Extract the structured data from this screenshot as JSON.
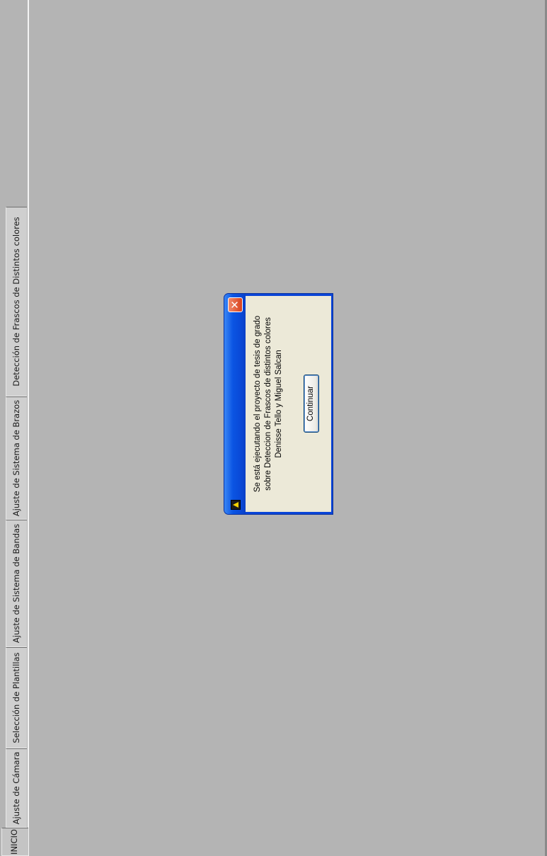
{
  "tabs": [
    {
      "label": "INICIO",
      "active": true
    },
    {
      "label": "Ajuste de Cámara",
      "active": false
    },
    {
      "label": "Selección de Plantillas",
      "active": false
    },
    {
      "label": "Ajuste de Sistema de Bandas",
      "active": false
    },
    {
      "label": "Ajuste de Sistema de Brazos",
      "active": false
    },
    {
      "label": "Detección de Frascos de Distintos colores",
      "active": false
    }
  ],
  "dialog": {
    "message_lines": [
      "Se está ejecutando el proyecto de tesis de grado",
      "sobre Deteccion de Frascos de distintos colores",
      "Denisse Tello y Miguel Salcan"
    ],
    "button_label": "Continuar",
    "close_glyph": "✕",
    "app_icon": "labview-warning-icon",
    "close_icon": "close-icon"
  },
  "colors": {
    "background": "#b4b4b4",
    "titlebar": "#0a48d6",
    "dialog_body": "#ece9d8",
    "close_button": "#d8401c"
  }
}
